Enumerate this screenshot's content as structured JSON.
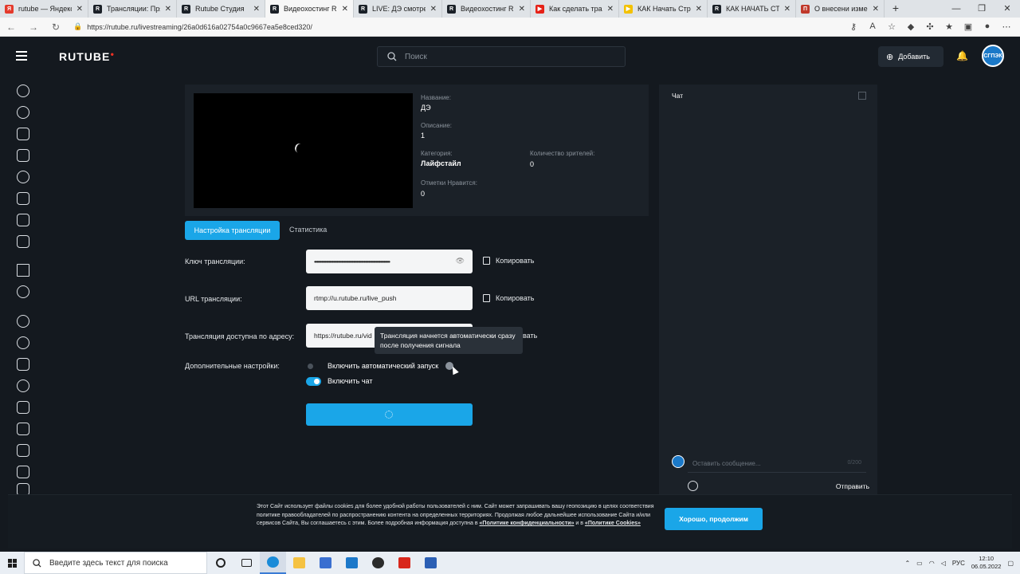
{
  "browser": {
    "tabs": [
      {
        "title": "rutube — Яндекс",
        "fav": "Я",
        "color": "#e43a2c"
      },
      {
        "title": "Трансляции: Пря",
        "fav": "R",
        "color": "#1b2128"
      },
      {
        "title": "Rutube Студия",
        "fav": "R",
        "color": "#1b2128"
      },
      {
        "title": "Видеохостинг Ru",
        "fav": "R",
        "color": "#1b2128"
      },
      {
        "title": "LIVE: ДЭ смотреть",
        "fav": "R",
        "color": "#1b2128"
      },
      {
        "title": "Видеохостинг Ru",
        "fav": "R",
        "color": "#1b2128"
      },
      {
        "title": "Как сделать тран",
        "fav": "▶",
        "color": "#e62117"
      },
      {
        "title": "КАК Начать Стри",
        "fav": "▶",
        "color": "#f3c100"
      },
      {
        "title": "КАК НАЧАТЬ СТР",
        "fav": "R",
        "color": "#1b2128"
      },
      {
        "title": "О внесени измене",
        "fav": "П",
        "color": "#c0392b"
      }
    ],
    "active_tab": 3,
    "url": "https://rutube.ru/livestreaming/26a0d616a02754a0c9667ea5e8ced320/"
  },
  "header": {
    "logo": "RUTUBE",
    "search_placeholder": "Поиск",
    "add_label": "Добавить",
    "avatar_text": "СГПЭК"
  },
  "stream_info": {
    "name_label": "Название:",
    "name_value": "ДЭ",
    "desc_label": "Описание:",
    "desc_value": "1",
    "category_label": "Категория:",
    "category_value": "Лайфстайл",
    "viewers_label": "Количество зрителей:",
    "viewers_value": "0",
    "likes_label": "Отметки Нравится:",
    "likes_value": "0"
  },
  "tabs": {
    "settings": "Настройка трансляции",
    "stats": "Статистика"
  },
  "form": {
    "key_label": "Ключ трансляции:",
    "key_value": "••••••••••••••••••••••••••••••••••••••••••••••••••••••••••••••••",
    "url_label": "URL трансляции:",
    "url_value": "rtmp://u.rutube.ru/live_push",
    "address_label": "Трансляция доступна по адресу:",
    "address_value": "https://rutube.ru/vid",
    "copy_label": "Копировать",
    "copy_label_partial": "вать",
    "extra_label": "Дополнительные настройки:",
    "autostart_label": "Включить автоматический запуск",
    "chat_label": "Включить чат",
    "tooltip": "Трансляция начнется автоматически сразу после получения сигнала"
  },
  "chat": {
    "title": "Чат",
    "input_placeholder": "Оставить сообщение...",
    "counter": "0/200",
    "send_label": "Отправить"
  },
  "cookie": {
    "text": "Этот Сайт использует файлы cookies для более удобной работы пользователей с ним. Сайт может запрашивать вашу геопозицию в целях соответствия политике правообладателей по распространению контента на определенных территориях. Продолжая любое дальнейшее использование Сайта и/или сервисов Сайта, Вы соглашаетесь с этим. Более подробная информация доступна в ",
    "link1": "«Политике конфиденциальности»",
    "mid": " и в ",
    "link2": "«Политике Cookies»",
    "button": "Хорошо, продолжим"
  },
  "taskbar": {
    "search_placeholder": "Введите здесь текст для поиска",
    "lang": "РУС",
    "time": "12:10",
    "date": "06.05.2022"
  }
}
